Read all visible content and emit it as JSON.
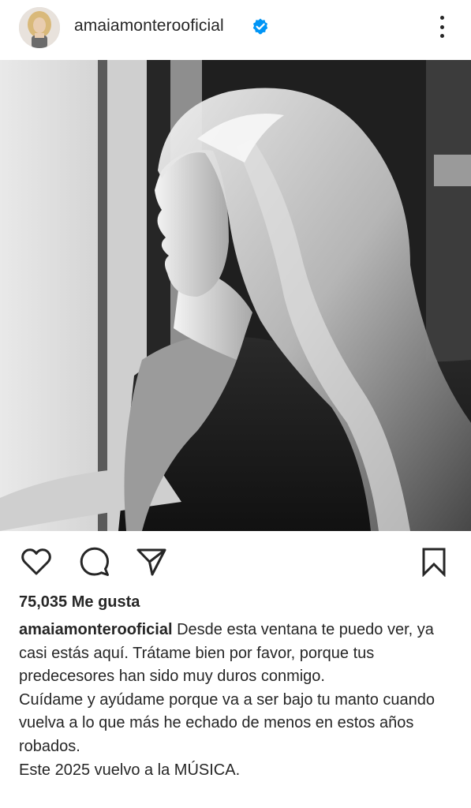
{
  "post": {
    "username": "amaiamonterooficial",
    "verified": true,
    "likes_text": "75,035 Me gusta",
    "caption_user": "amaiamonterooficial",
    "caption_lines": [
      "Desde esta ventana te puedo ver, ya casi estás aquí.  Trátame bien por favor, porque tus predecesores han sido muy duros conmigo.",
      "Cuídame y ayúdame porque va a ser bajo tu manto cuando vuelva a lo que más he echado de menos en estos años robados.",
      "Este 2025 vuelvo a la MÚSICA."
    ]
  },
  "icons": {
    "verified": "verified-badge-icon",
    "more": "more-options-icon",
    "like": "heart-icon",
    "comment": "comment-icon",
    "share": "send-icon",
    "save": "bookmark-icon"
  },
  "colors": {
    "verified_blue": "#0095f6",
    "text": "#262626"
  }
}
